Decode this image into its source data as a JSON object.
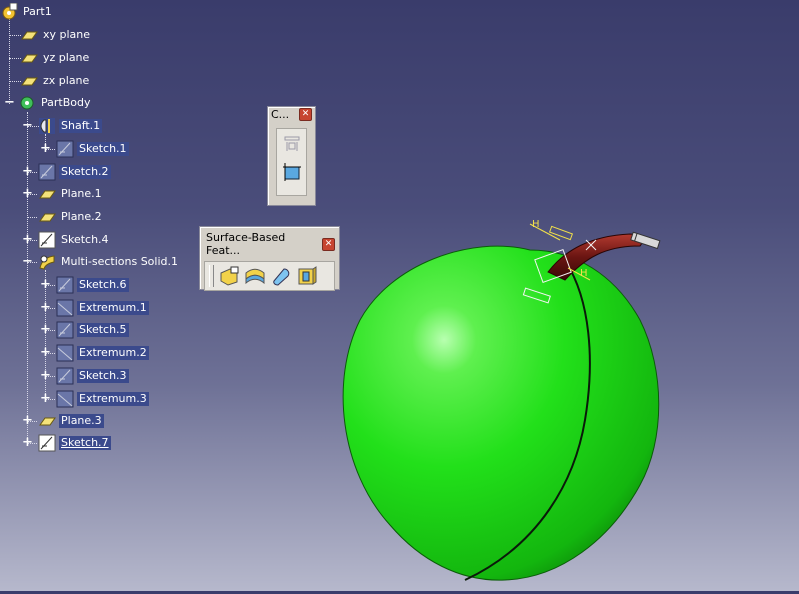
{
  "tree": {
    "root": "Part1",
    "planes": [
      "xy plane",
      "yz plane",
      "zx plane"
    ],
    "body": "PartBody",
    "items": {
      "shaft": "Shaft.1",
      "sketch1": "Sketch.1",
      "sketch2": "Sketch.2",
      "plane1": "Plane.1",
      "plane2": "Plane.2",
      "sketch4": "Sketch.4",
      "msolid": "Multi-sections Solid.1",
      "sketch6": "Sketch.6",
      "extremum1": "Extremum.1",
      "sketch5": "Sketch.5",
      "extremum2": "Extremum.2",
      "sketch3": "Sketch.3",
      "extremum3": "Extremum.3",
      "plane3": "Plane.3",
      "sketch7": "Sketch.7"
    }
  },
  "toolbars": {
    "constraints": {
      "title": "C..."
    },
    "surface": {
      "title": "Surface-Based Feat..."
    }
  },
  "viewport": {
    "apple_color": "#22e01a",
    "stem_color": "#6a1512"
  }
}
